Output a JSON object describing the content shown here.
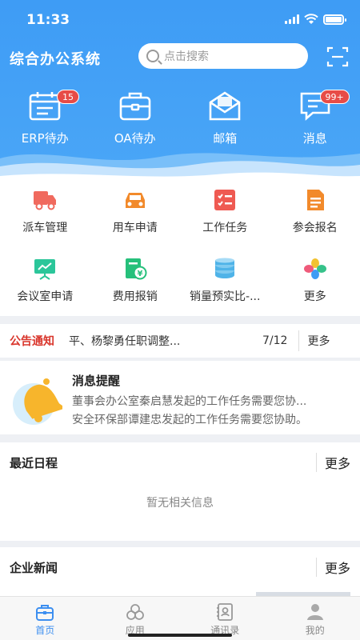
{
  "status": {
    "time": "11:33"
  },
  "header": {
    "title": "综合办公系统",
    "search_placeholder": "点击搜索",
    "scan_icon": "scan-icon"
  },
  "quick": [
    {
      "label": "ERP待办",
      "icon": "calendar-icon",
      "badge": "15"
    },
    {
      "label": "OA待办",
      "icon": "briefcase-icon",
      "badge": ""
    },
    {
      "label": "邮箱",
      "icon": "mailbox-icon",
      "badge": ""
    },
    {
      "label": "消息",
      "icon": "chat-icon",
      "badge": "99+"
    }
  ],
  "grid": [
    {
      "label": "派车管理",
      "icon": "truck-icon"
    },
    {
      "label": "用车申请",
      "icon": "car-icon"
    },
    {
      "label": "工作任务",
      "icon": "checklist-icon"
    },
    {
      "label": "参会报名",
      "icon": "document-icon"
    },
    {
      "label": "会议室申请",
      "icon": "presentation-icon"
    },
    {
      "label": "费用报销",
      "icon": "yuan-receipt-icon"
    },
    {
      "label": "销量预实比-...",
      "icon": "coins-icon"
    },
    {
      "label": "更多",
      "icon": "more-apps-icon"
    }
  ],
  "notice": {
    "tag": "公告通知",
    "text": "平、杨黎勇任职调整...",
    "page": "7/12",
    "more": "更多"
  },
  "message": {
    "title": "消息提醒",
    "line1": "董事会办公室秦启慧发起的工作任务需要您协...",
    "line2": "安全环保部谭建忠发起的工作任务需要您协助。"
  },
  "schedule": {
    "title": "最近日程",
    "more": "更多",
    "empty": "暂无相关信息"
  },
  "news": {
    "title": "企业新闻",
    "more": "更多"
  },
  "tabs": [
    {
      "label": "首页",
      "icon": "home-icon"
    },
    {
      "label": "应用",
      "icon": "apps-icon"
    },
    {
      "label": "通讯录",
      "icon": "contacts-icon"
    },
    {
      "label": "我的",
      "icon": "user-icon"
    }
  ],
  "colors": {
    "primary": "#3e9cf5",
    "badge": "#e74c47",
    "notice_tag": "#d9352b",
    "active_tab": "#3d8ff0"
  }
}
